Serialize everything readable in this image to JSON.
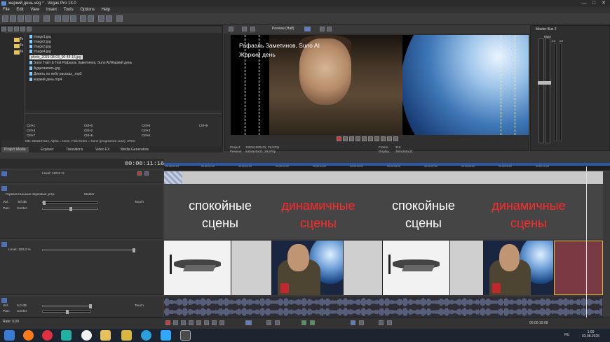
{
  "window": {
    "title": "жаркий день.veg * - Vegas Pro 13.0",
    "controls": [
      "—",
      "□",
      "✕"
    ]
  },
  "menu": [
    "File",
    "Edit",
    "View",
    "Insert",
    "Tools",
    "Options",
    "Help"
  ],
  "explorer": {
    "tree_items": [
      "Te",
      "Te",
      "Te"
    ],
    "files": [
      "Image1.jpg",
      "Image2.jpg",
      "Image3.jpg",
      "Image4.jpg",
      "photo_2025-08-03_00-49-16.jpg",
      "Suno Train & Test Рафаэль Заметинов, Suno AI/Жаркий день",
      "Аудиозапись.jpg",
      "Девять по небу рассказ_.mp3",
      "жаркий день.mp4"
    ],
    "selected_file_index": 4,
    "regions": [
      "Ctrl+1",
      "Ctrl+4",
      "Ctrl+7",
      "Ctrl+0",
      "Ctrl+2",
      "Ctrl+5",
      "Ctrl+8",
      "Ctrl+3",
      "Ctrl+6",
      "Ctrl+9"
    ],
    "status": "MB, 685x537x24, Alpha = None, Field Order = None (progressive scan), JPEG"
  },
  "tabs": [
    "Project Media",
    "Explorer",
    "Transitions",
    "Video FX",
    "Media Generators"
  ],
  "preview": {
    "quality": "Preview (Half)",
    "caption_line1": "Рафаэль Заметинов, Suno AI",
    "caption_line2": "Жаркий день",
    "info_project_label": "Project:",
    "info_project": "1080x1080x32, 29,970p",
    "info_preview_label": "Preview:",
    "info_preview": "540x540x32, 29,970p",
    "info_frame_label": "Frame:",
    "info_frame": "316",
    "info_display_label": "Display:",
    "info_display": "360x360x32"
  },
  "master": {
    "title": "Master Bus",
    "channels": "2",
    "mute_label": "Mute",
    "levels": [
      "-Inf",
      "-Inf"
    ]
  },
  "timeline": {
    "timecode": "00:00:11:16",
    "ruler_ticks": [
      "00:00:00:00",
      "00:00:01:00",
      "00:00:02:00",
      "00:00:03:00",
      "00:00:04:00",
      "00:00:05:00",
      "00:00:06:00",
      "00:00:07:00",
      "00:00:08:00",
      "00:00:09:00",
      "00:00:10:00"
    ],
    "scenes": [
      {
        "line1": "спокойные",
        "line2": "сцены",
        "kind": "calm"
      },
      {
        "line1": "динамичные",
        "line2": "сцены",
        "kind": "dyn"
      },
      {
        "line1": "спокойные",
        "line2": "сцены",
        "kind": "calm"
      },
      {
        "line1": "динамичные",
        "line2": "сцены",
        "kind": "dyn"
      }
    ],
    "accent_red": "#ff2a2a"
  },
  "tracks": {
    "t1_level": "Level: 100,0 %",
    "t2_name": "Горизонтальные звуковые устр.",
    "t2_master": "Master",
    "t2_vol_label": "Vol:",
    "t2_vol": "-inf dB",
    "t2_pan_label": "Pan:",
    "t2_pan": "Center",
    "t2_touch": "Touch",
    "t3_level": "Level: 100,0 %",
    "t4_vol_label": "Vol:",
    "t4_vol": "0,0 dB",
    "t4_pan_label": "Pan:",
    "t4_pan": "Center",
    "t4_touch": "Touch"
  },
  "bottom": {
    "rate": "Rate: 0,00",
    "end_time": "00:00:10:08"
  },
  "taskbar": {
    "lang": "RU",
    "time": "1:00",
    "date": "03.08.2025"
  }
}
